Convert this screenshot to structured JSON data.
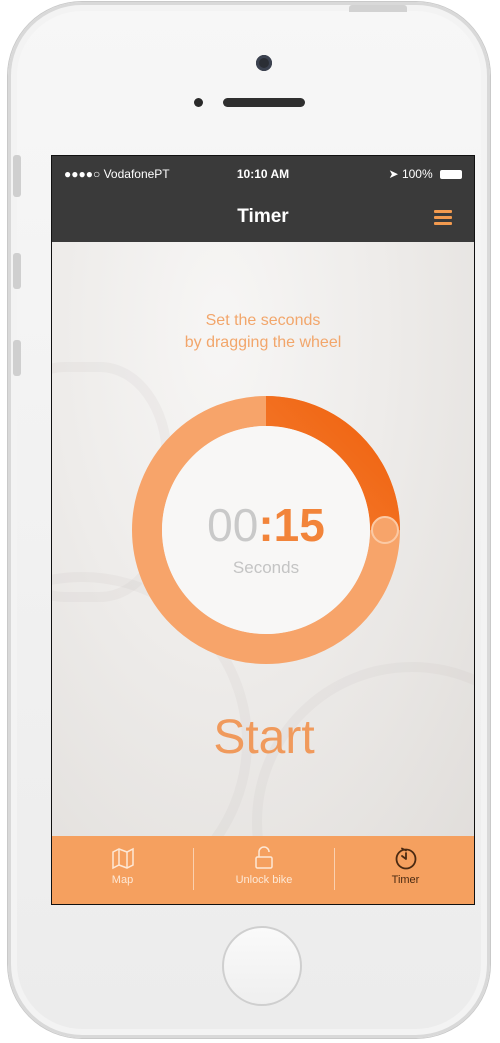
{
  "status_bar": {
    "carrier": "●●●●○ VodafonePT",
    "time": "10:10 AM",
    "battery": "100%"
  },
  "nav": {
    "title": "Timer",
    "menu_icon": "hamburger-menu-icon"
  },
  "timer": {
    "instructions_line1": "Set the seconds",
    "instructions_line2": "by dragging the wheel",
    "minutes": "00",
    "separator": ":",
    "seconds": "15",
    "unit_label": "Seconds",
    "progress_fraction": 0.25
  },
  "start_label": "Start",
  "tabs": [
    {
      "label": "Map",
      "icon": "map-icon",
      "active": false
    },
    {
      "label": "Unlock bike",
      "icon": "unlock-icon",
      "active": false
    },
    {
      "label": "Timer",
      "icon": "timer-icon",
      "active": true
    }
  ],
  "colors": {
    "accent": "#f2843a",
    "ring": "#f7a46a",
    "tab_bar": "#f5a05f",
    "nav_bar": "#3a3a3a"
  }
}
